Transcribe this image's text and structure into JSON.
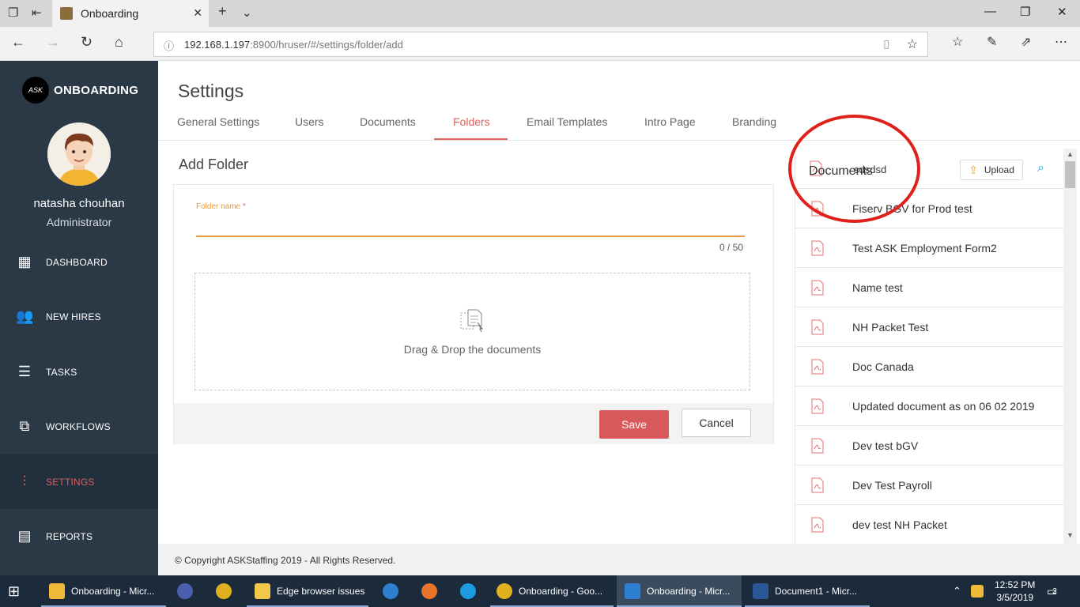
{
  "browser": {
    "tab_title": "Onboarding",
    "url_host": "192.168.1.197",
    "url_rest": ":8900/hruser/#/settings/folder/add"
  },
  "sidebar": {
    "logo_mark": "ASK",
    "logo_text": "ONBOARDING",
    "user_name": "natasha chouhan",
    "user_role": "Administrator",
    "items": [
      {
        "label": "DASHBOARD",
        "icon": "dashboard-icon"
      },
      {
        "label": "NEW HIRES",
        "icon": "people-icon"
      },
      {
        "label": "TASKS",
        "icon": "tasks-icon"
      },
      {
        "label": "WORKFLOWS",
        "icon": "workflow-icon"
      },
      {
        "label": "SETTINGS",
        "icon": "sliders-icon"
      },
      {
        "label": "REPORTS",
        "icon": "report-icon"
      }
    ],
    "active_color": "#e05c5c"
  },
  "header": {
    "title": "Settings",
    "tabs": [
      "General Settings",
      "Users",
      "Documents",
      "Folders",
      "Email Templates",
      "Intro Page",
      "Branding"
    ],
    "active_tab": "Folders"
  },
  "form": {
    "title": "Add Folder",
    "field_label": "Folder name",
    "required_mark": "*",
    "field_value": "",
    "counter": "0 / 50",
    "dropzone_text": "Drag & Drop the documents",
    "save_label": "Save",
    "cancel_label": "Cancel"
  },
  "documents": {
    "title": "Documents",
    "overlap_text": "sdsdsd",
    "upload_label": "Upload",
    "items": [
      "Fiserv BGV for Prod test",
      "Test ASK Employment Form2",
      "Name test",
      "NH Packet Test",
      "Doc Canada",
      "Updated document as on 06 02 2019",
      "Dev test bGV",
      "Dev Test Payroll",
      "dev test NH Packet"
    ]
  },
  "footer": {
    "copyright": "© Copyright ASKStaffing 2019 - All Rights Reserved."
  },
  "taskbar": {
    "items": [
      {
        "label": "Onboarding - Micr...",
        "color": "#f0b93a"
      },
      {
        "label": "",
        "color": "#4b5fb0"
      },
      {
        "label": "",
        "color": "#e0b020"
      },
      {
        "label": "Edge browser issues",
        "color": "#f3c84b"
      },
      {
        "label": "",
        "color": "#2f7fd0"
      },
      {
        "label": "",
        "color": "#e8742a"
      },
      {
        "label": "",
        "color": "#1d9be0"
      },
      {
        "label": "Onboarding - Goo...",
        "color": "#e0b020"
      },
      {
        "label": "Onboarding - Micr...",
        "color": "#2f7fd0"
      },
      {
        "label": "Document1 - Micr...",
        "color": "#2b5797"
      }
    ],
    "time": "12:52 PM",
    "date": "3/5/2019",
    "notifications": "2"
  }
}
